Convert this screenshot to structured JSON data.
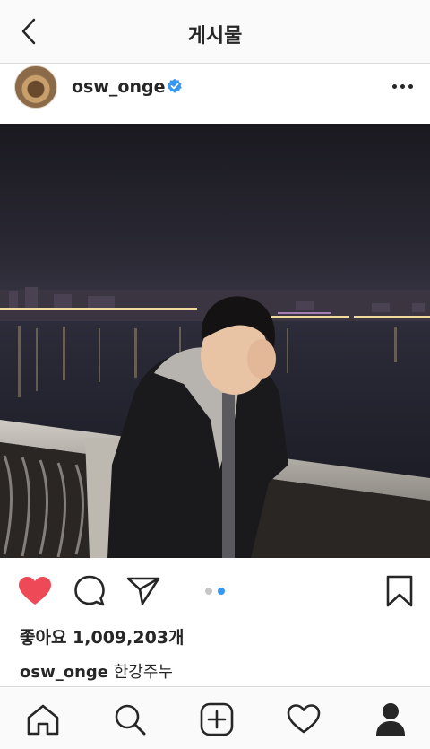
{
  "header": {
    "title": "게시물"
  },
  "post": {
    "username": "osw_onge",
    "verified": true,
    "likes_text": "좋아요 1,009,203개",
    "caption_user": "osw_onge",
    "caption_text": "한강주누",
    "carousel": {
      "count": 2,
      "active_index": 1
    },
    "liked": true
  },
  "icons": {
    "back": "chevron-left-icon",
    "verified": "verified-badge-icon",
    "more": "more-horizontal-icon",
    "like": "heart-filled-icon",
    "comment": "comment-bubble-icon",
    "share": "send-paper-plane-icon",
    "save": "bookmark-icon"
  },
  "tabs": [
    "home-icon",
    "search-icon",
    "new-post-icon",
    "activity-heart-icon",
    "profile-icon"
  ],
  "colors": {
    "like": "#ed4956",
    "verified": "#3897f0",
    "active_dot": "#3897f0",
    "inactive_dot": "#c7c7c7"
  }
}
